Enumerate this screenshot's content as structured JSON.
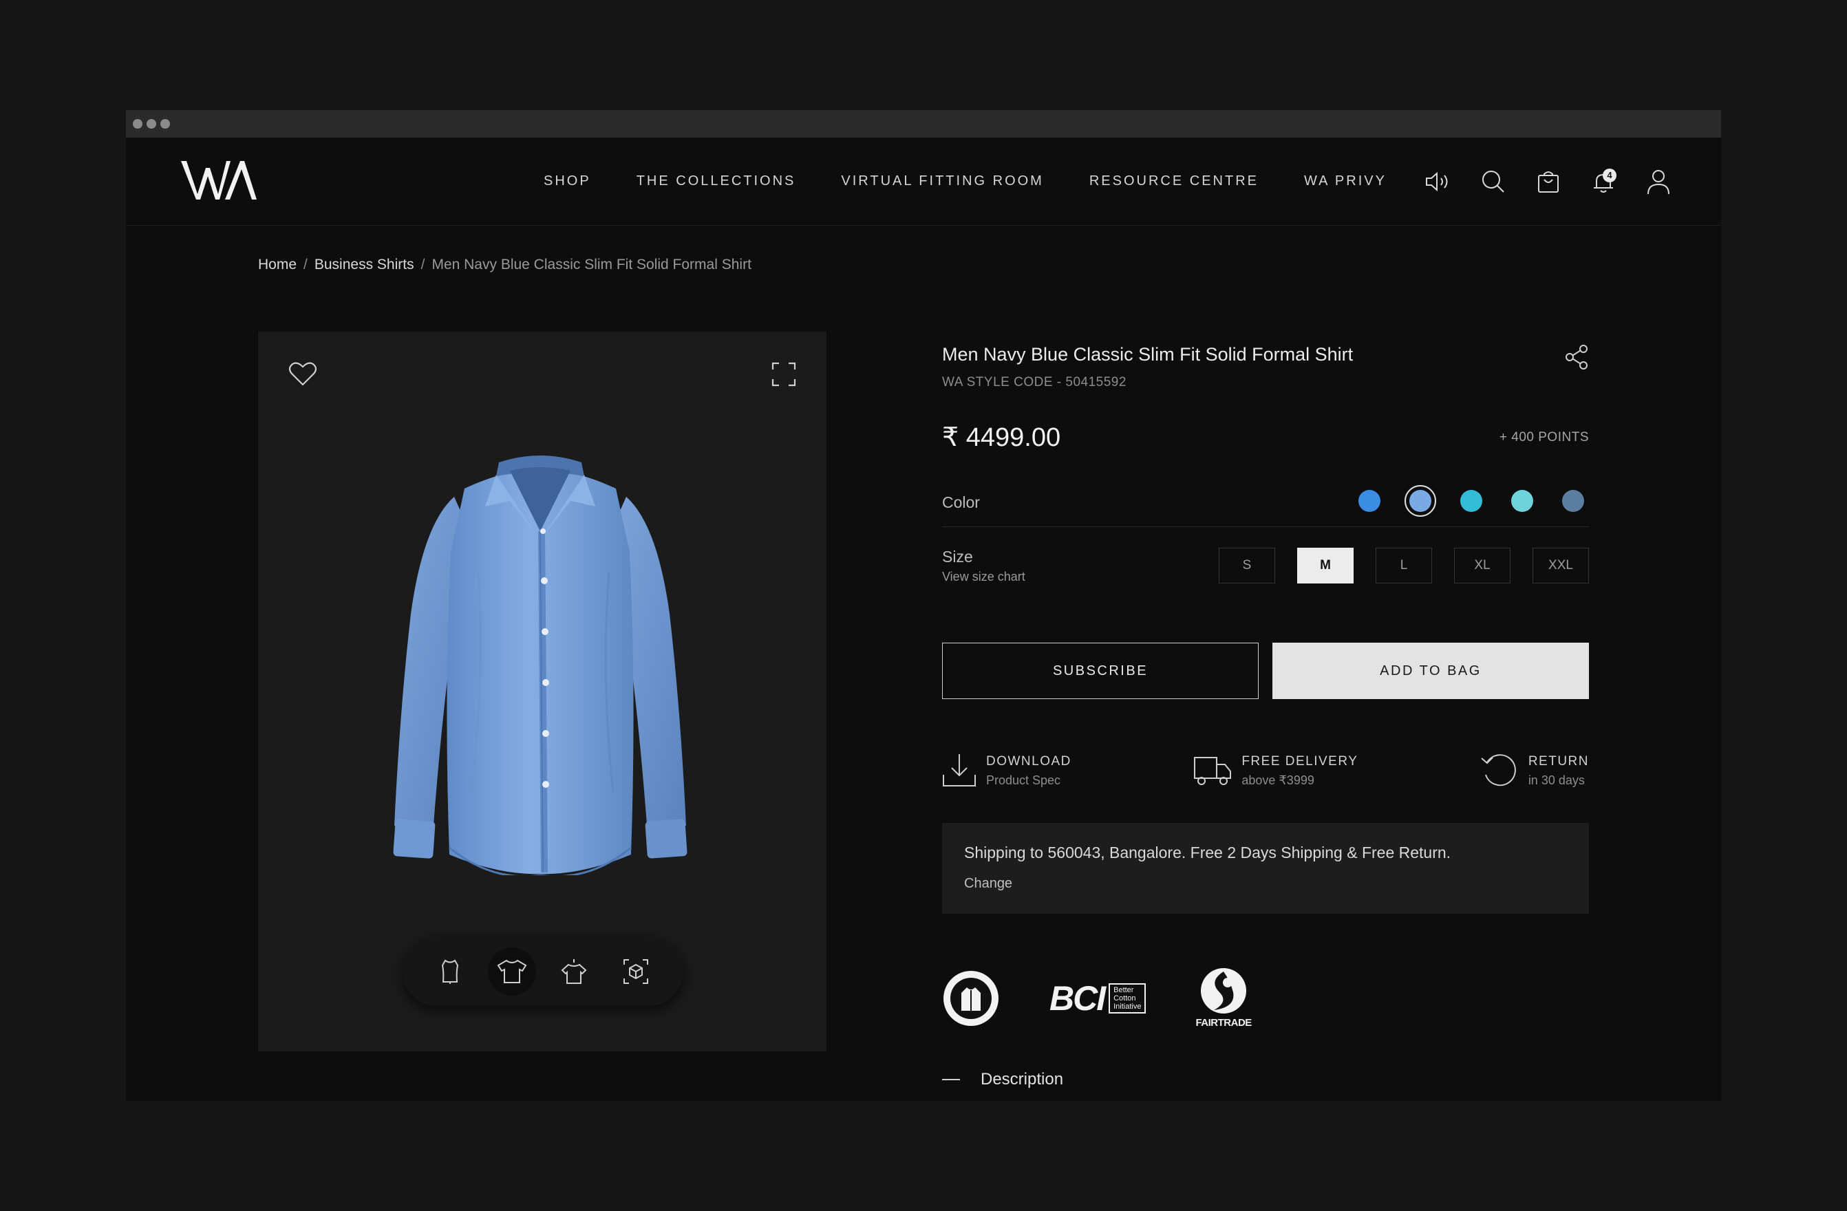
{
  "brand": {
    "logo_text": "WA"
  },
  "nav": {
    "links": [
      "SHOP",
      "THE COLLECTIONS",
      "VIRTUAL FITTING ROOM",
      "RESOURCE CENTRE",
      "WA PRIVY"
    ],
    "notifications_count": "4"
  },
  "breadcrumb": {
    "home": "Home",
    "category": "Business Shirts",
    "current": "Men Navy Blue Classic Slim Fit Solid Formal Shirt",
    "separator": "/"
  },
  "product": {
    "title": "Men Navy Blue Classic Slim Fit Solid Formal Shirt",
    "style_code": "WA STYLE CODE - 50415592",
    "price": "₹ 4499.00",
    "points": "+ 400 POINTS",
    "color_label": "Color",
    "colors": [
      "#3a8de3",
      "#7aaae6",
      "#32bdd6",
      "#6fd3dc",
      "#5d7f9f"
    ],
    "selected_color_index": 1,
    "size_label": "Size",
    "size_chart_link": "View size chart",
    "sizes": [
      "S",
      "M",
      "L",
      "XL",
      "XXL"
    ],
    "selected_size": "M",
    "subscribe_label": "SUBSCRIBE",
    "add_to_bag_label": "ADD TO BAG"
  },
  "features": [
    {
      "title": "DOWNLOAD",
      "sub": "Product Spec",
      "icon": "download-icon"
    },
    {
      "title": "FREE DELIVERY",
      "sub": "above ₹3999",
      "icon": "truck-icon"
    },
    {
      "title": "RETURN",
      "sub": "in 30 days",
      "icon": "return-icon"
    }
  ],
  "shipping": {
    "text": "Shipping to 560043, Bangalore. Free 2 Days Shipping & Free Return.",
    "change_label": "Change"
  },
  "certifications": {
    "bci_text": "BCI",
    "bci_sub_1": "Better",
    "bci_sub_2": "Cotton",
    "bci_sub_3": "Initiative",
    "fairtrade_text": "FAIRTRADE"
  },
  "description_label": "Description",
  "colors": {
    "background": "#0d0d0d",
    "panel": "#1b1b1b",
    "shirt": "#7aa3d8"
  }
}
